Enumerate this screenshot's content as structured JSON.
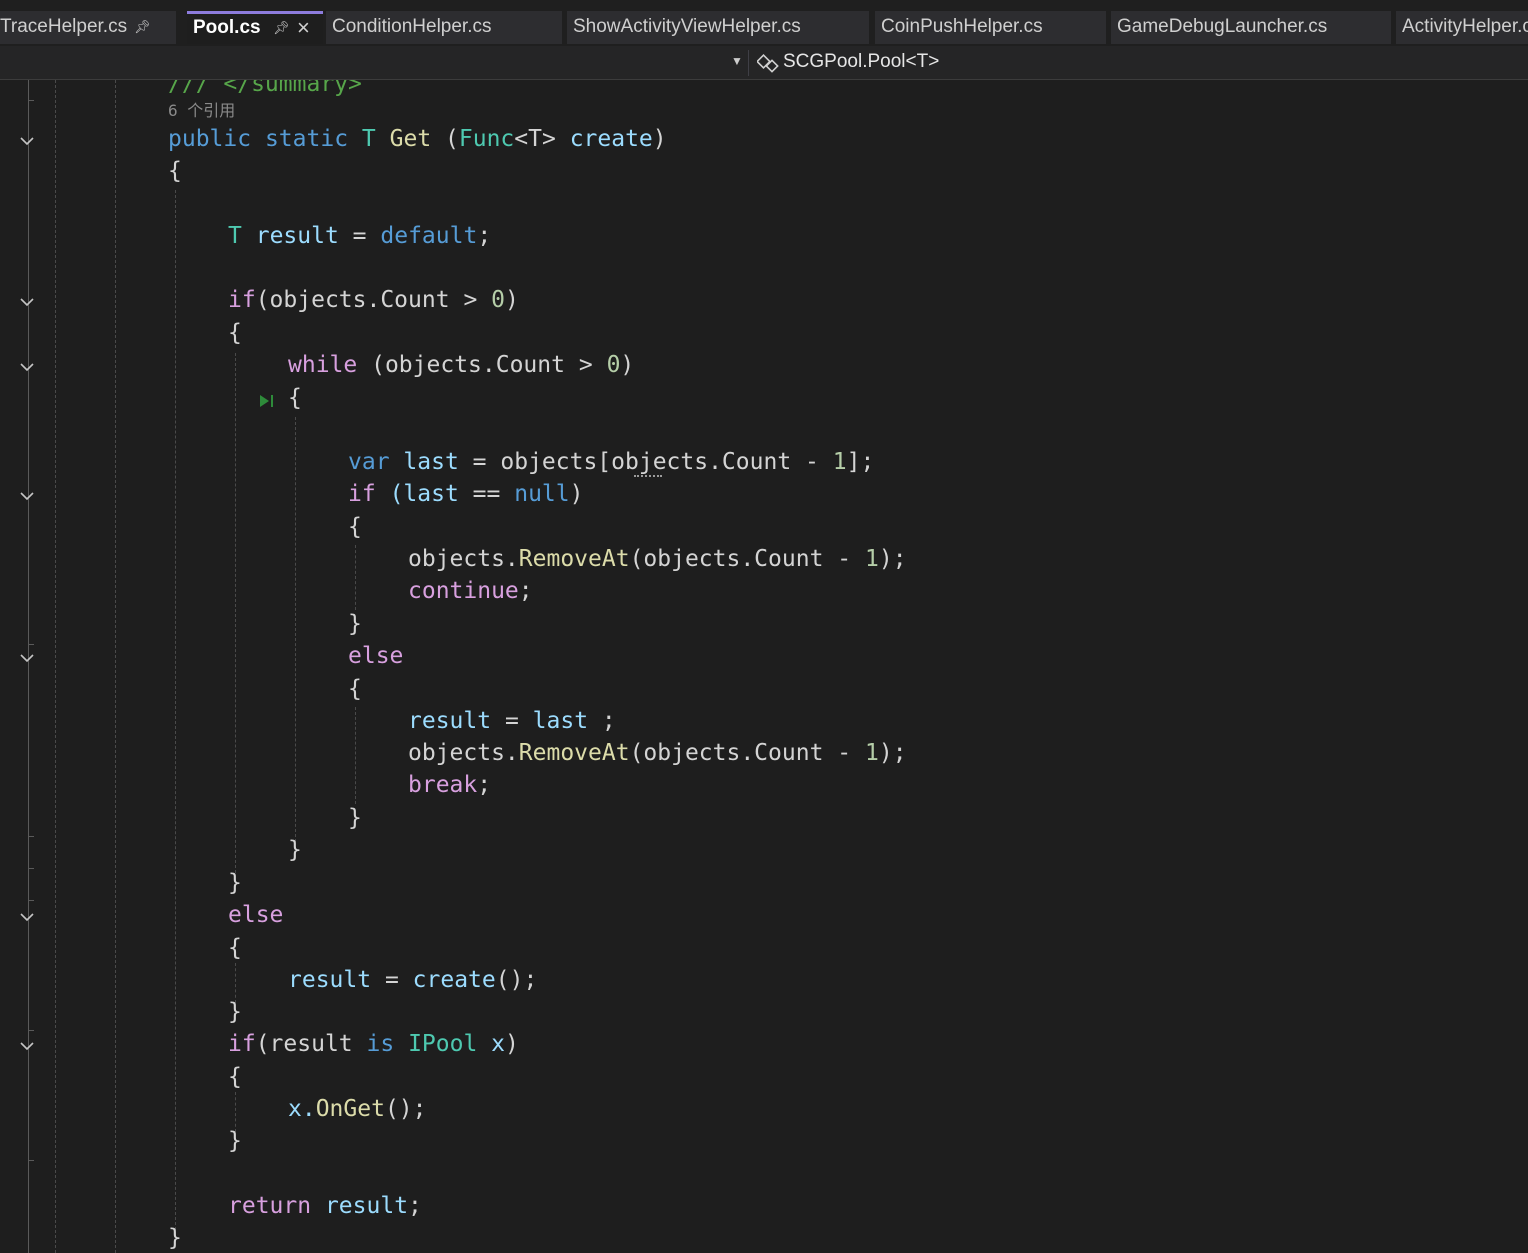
{
  "tabs": [
    {
      "label": "TraceHelper.cs",
      "pinned": true,
      "active": false
    },
    {
      "label": "Pool.cs",
      "pinned": true,
      "active": true
    },
    {
      "label": "ConditionHelper.cs",
      "pinned": false,
      "active": false
    },
    {
      "label": "ShowActivityViewHelper.cs",
      "pinned": false,
      "active": false
    },
    {
      "label": "CoinPushHelper.cs",
      "pinned": false,
      "active": false
    },
    {
      "label": "GameDebugLauncher.cs",
      "pinned": false,
      "active": false
    },
    {
      "label": "ActivityHelper.cs",
      "pinned": false,
      "active": false
    }
  ],
  "icons": {
    "pin": "pin-icon",
    "close": "close-icon",
    "nav_dropdown": "chevron-down-icon",
    "class_member": "class-member-icon",
    "fold": "chevron-down-icon",
    "current_statement": "step-over-icon"
  },
  "navbar": {
    "member_label": "SCGPool.Pool<T>"
  },
  "editor": {
    "codelens": "6 个引用",
    "lines": {
      "l0": "/// </summary>",
      "l1_a": "public",
      "l1_b": "static",
      "l1_c": "T",
      "l1_d": "Get",
      "l1_e": "(",
      "l1_f": "Func",
      "l1_g": "<T>",
      "l1_h": "create",
      "l1_i": ")",
      "l2": "{",
      "l3_a": "T",
      "l3_b": "result",
      "l3_c": "=",
      "l3_d": "default",
      "l3_e": ";",
      "l4_a": "if",
      "l4_b": "(objects.Count",
      "l4_c": ">",
      "l4_d": "0",
      "l4_e": ")",
      "l5": "{",
      "l6_a": "while",
      "l6_b": "(objects.Count",
      "l6_c": ">",
      "l6_d": "0",
      "l6_e": ")",
      "l7": "{",
      "l8_a": "var",
      "l8_b": "last",
      "l8_c": "=",
      "l8_d": "objects[objects.Count",
      "l8_e": "-",
      "l8_f": "1",
      "l8_g": "];",
      "l9_a": "if",
      "l9_b": "(last",
      "l9_c": "==",
      "l9_d": "null",
      "l9_e": ")",
      "l10": "{",
      "l11_a": "objects.",
      "l11_b": "RemoveAt",
      "l11_c": "(objects.Count",
      "l11_d": "-",
      "l11_e": "1",
      "l11_f": ");",
      "l12_a": "continue",
      "l12_b": ";",
      "l13": "}",
      "l14": "else",
      "l15": "{",
      "l16_a": "result",
      "l16_b": "=",
      "l16_c": "last",
      "l16_d": ";",
      "l17_a": "objects.",
      "l17_b": "RemoveAt",
      "l17_c": "(objects.Count",
      "l17_d": "-",
      "l17_e": "1",
      "l17_f": ");",
      "l18_a": "break",
      "l18_b": ";",
      "l19": "}",
      "l20": "}",
      "l21": "}",
      "l22": "else",
      "l23": "{",
      "l24_a": "result",
      "l24_b": "=",
      "l24_c": "create",
      "l24_d": "();",
      "l25": "}",
      "l26_a": "if",
      "l26_b": "(result",
      "l26_c": "is",
      "l26_d": "IPool",
      "l26_e": "x",
      "l26_f": ")",
      "l27": "{",
      "l28_a": "x.",
      "l28_b": "OnGet",
      "l28_c": "();",
      "l29": "}",
      "l30_a": "return",
      "l30_b": "result",
      "l30_c": ";",
      "l31": "}"
    }
  },
  "colors": {
    "keyword": "#569cd6",
    "control": "#d8a0df",
    "type": "#4ec9b0",
    "method": "#dcdcaa",
    "identifier": "#9cdcfe",
    "number": "#b5cea8",
    "comment": "#57a64a",
    "background": "#1e1e1e",
    "active_tab_accent": "#8d7cdd"
  }
}
